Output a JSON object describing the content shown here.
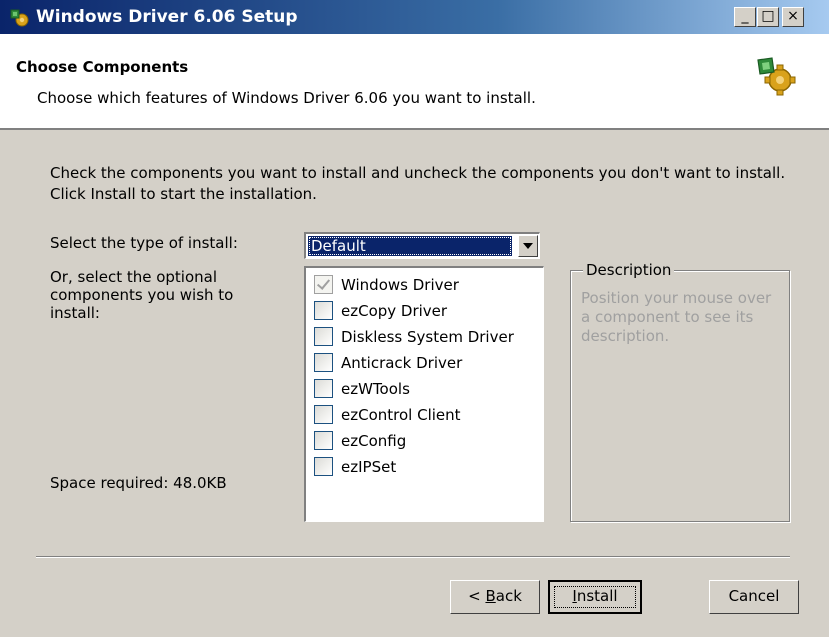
{
  "window": {
    "title": "Windows Driver 6.06 Setup",
    "controls": {
      "minimize": "_",
      "maximize": "□",
      "close": "×"
    }
  },
  "header": {
    "title": "Choose Components",
    "subtitle": "Choose which features of Windows Driver 6.06 you want to install.",
    "icon": "installer-icon"
  },
  "instructions": "Check the components you want to install and uncheck the components you don't want to install. Click Install to start the installation.",
  "install_type": {
    "label": "Select the type of install:",
    "selected": "Default"
  },
  "optional": {
    "label": "Or, select the optional components you wish to install:"
  },
  "components": [
    {
      "label": "Windows Driver",
      "checked": true,
      "disabled": true
    },
    {
      "label": "ezCopy Driver",
      "checked": false
    },
    {
      "label": "Diskless System Driver",
      "checked": false
    },
    {
      "label": "Anticrack Driver",
      "checked": false
    },
    {
      "label": "ezWTools",
      "checked": false
    },
    {
      "label": "ezControl Client",
      "checked": false
    },
    {
      "label": "ezConfig",
      "checked": false
    },
    {
      "label": "ezIPSet",
      "checked": false
    }
  ],
  "description": {
    "legend": "Description",
    "text": "Position your mouse over a component to see its description."
  },
  "space_required": "Space required: 48.0KB",
  "buttons": {
    "back_prefix": "< ",
    "back_mnemonic": "B",
    "back_rest": "ack",
    "install_mnemonic": "I",
    "install_rest": "nstall",
    "cancel": "Cancel"
  }
}
